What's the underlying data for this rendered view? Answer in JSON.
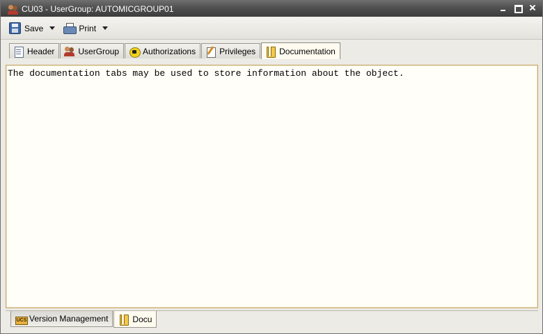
{
  "window": {
    "title": "CU03 - UserGroup: AUTOMICGROUP01",
    "app_icon": "user-group-icon"
  },
  "toolbar": {
    "save_label": "Save",
    "print_label": "Print"
  },
  "tabs": [
    {
      "label": "Header",
      "icon": "header-icon",
      "active": false
    },
    {
      "label": "UserGroup",
      "icon": "users-icon",
      "active": false
    },
    {
      "label": "Authorizations",
      "icon": "lock-icon",
      "active": false
    },
    {
      "label": "Privileges",
      "icon": "privileges-icon",
      "active": false
    },
    {
      "label": "Documentation",
      "icon": "documentation-icon",
      "active": true
    }
  ],
  "content": {
    "text": "The documentation tabs may be used to store information about the object."
  },
  "bottom_tabs": [
    {
      "label": "Version Management",
      "icon": "ucs-icon",
      "active": false
    },
    {
      "label": "Docu",
      "icon": "documentation-icon",
      "active": true
    }
  ]
}
